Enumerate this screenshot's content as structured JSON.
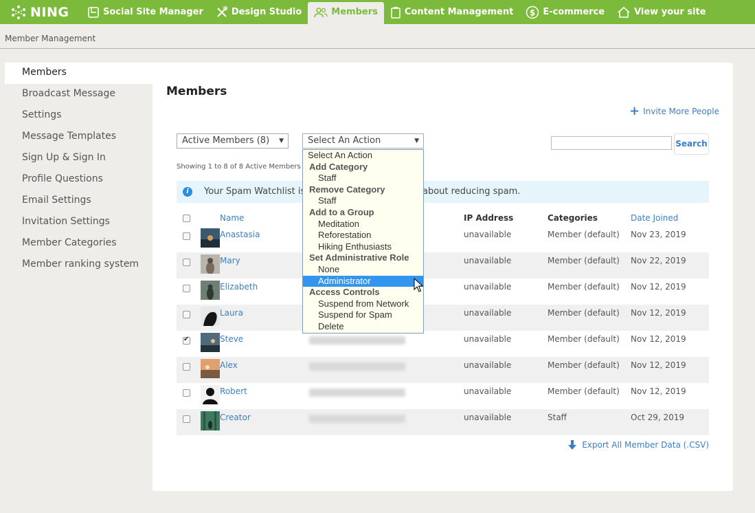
{
  "app": {
    "logo": "NING"
  },
  "nav": [
    {
      "label": "Social Site Manager",
      "icon": "square-check-icon"
    },
    {
      "label": "Design Studio",
      "icon": "tools-icon"
    },
    {
      "label": "Members",
      "icon": "people-icon",
      "active": true
    },
    {
      "label": "Content Management",
      "icon": "clipboard-icon"
    },
    {
      "label": "E-commerce",
      "icon": "dollar-icon"
    },
    {
      "label": "View your site",
      "icon": "home-icon"
    }
  ],
  "breadcrumb": "Member Management",
  "sidebar": [
    {
      "label": "Members",
      "active": true
    },
    {
      "label": "Broadcast Message"
    },
    {
      "label": "Settings"
    },
    {
      "label": "Message Templates"
    },
    {
      "label": "Sign Up & Sign In"
    },
    {
      "label": "Profile Questions"
    },
    {
      "label": "Email Settings"
    },
    {
      "label": "Invitation Settings"
    },
    {
      "label": "Member Categories"
    },
    {
      "label": "Member ranking system"
    }
  ],
  "main": {
    "title": "Members",
    "invite_label": "Invite More People",
    "filter_value": "Active Members (8)",
    "action_value": "Select An Action",
    "search_button": "Search",
    "search_value": "",
    "showing": "Showing 1 to 8 of 8 Active Members",
    "notice_part1": "Your Spam Watchlist is",
    "notice_part2": "about reducing spam.",
    "columns": [
      "Name",
      "IP Address",
      "Categories",
      "Date Joined"
    ],
    "rows": [
      {
        "name": "Anastasia",
        "ip": "unavailable",
        "category": "Member (default)",
        "joined": "Nov 23, 2019",
        "checked": false
      },
      {
        "name": "Mary",
        "ip": "unavailable",
        "category": "Member (default)",
        "joined": "Nov 22, 2019",
        "checked": false
      },
      {
        "name": "Elizabeth",
        "ip": "unavailable",
        "category": "Member (default)",
        "joined": "Nov 12, 2019",
        "checked": false
      },
      {
        "name": "Laura",
        "ip": "unavailable",
        "category": "Member (default)",
        "joined": "Nov 12, 2019",
        "checked": false
      },
      {
        "name": "Steve",
        "ip": "unavailable",
        "category": "Member (default)",
        "joined": "Nov 12, 2019",
        "checked": true
      },
      {
        "name": "Alex",
        "ip": "unavailable",
        "category": "Member (default)",
        "joined": "Nov 12, 2019",
        "checked": false
      },
      {
        "name": "Robert",
        "ip": "unavailable",
        "category": "Member (default)",
        "joined": "Nov 12, 2019",
        "checked": false
      },
      {
        "name": "Creator",
        "ip": "unavailable",
        "category": "Staff",
        "joined": "Oct 29, 2019",
        "checked": false
      }
    ],
    "export_label": "Export All Member Data (.CSV)"
  },
  "action_menu": {
    "options": [
      {
        "label": "Select An Action",
        "kind": "lvl0"
      },
      {
        "label": "Add Category",
        "kind": "group"
      },
      {
        "label": "Staff",
        "kind": "lvl1"
      },
      {
        "label": "Remove Category",
        "kind": "group"
      },
      {
        "label": "Staff",
        "kind": "lvl1"
      },
      {
        "label": "Add to a Group",
        "kind": "group"
      },
      {
        "label": "Meditation",
        "kind": "lvl1"
      },
      {
        "label": "Reforestation",
        "kind": "lvl1"
      },
      {
        "label": "Hiking Enthusiasts",
        "kind": "lvl1"
      },
      {
        "label": "Set Administrative Role",
        "kind": "group"
      },
      {
        "label": "None",
        "kind": "lvl1"
      },
      {
        "label": "Administrator",
        "kind": "lvl1",
        "highlighted": true
      },
      {
        "label": "Access Controls",
        "kind": "group"
      },
      {
        "label": "Suspend from Network",
        "kind": "lvl1"
      },
      {
        "label": "Suspend for Spam",
        "kind": "lvl1"
      },
      {
        "label": "Delete",
        "kind": "lvl1"
      }
    ]
  },
  "colors": {
    "brand_green": "#7cba3b",
    "link_blue": "#3a7fc4",
    "highlight_blue": "#3296f0"
  }
}
